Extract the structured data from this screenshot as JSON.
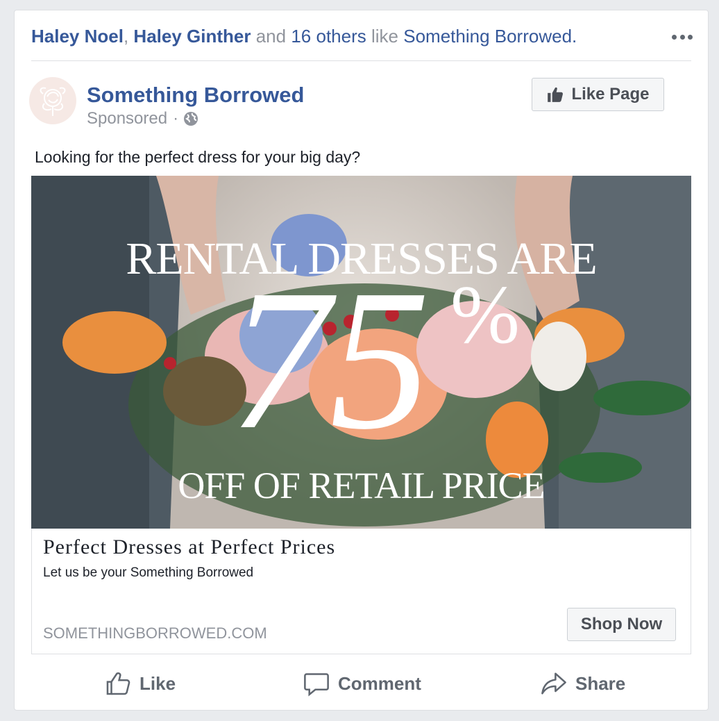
{
  "social_context": {
    "friend1": "Haley Noel",
    "separator": ",",
    "friend2": "Haley Ginther",
    "and": "and",
    "others": "16 others",
    "like": "like",
    "page": "Something Borrowed."
  },
  "post": {
    "page_name": "Something Borrowed",
    "sponsored": "Sponsored",
    "dot": "·",
    "like_page_label": "Like Page",
    "text": "Looking for the perfect dress for your big day?"
  },
  "image_text": {
    "line1": "RENTAL DRESSES ARE",
    "big_number": "75",
    "percent": "%",
    "line3": "OFF OF RETAIL PRICE"
  },
  "link_preview": {
    "headline": "Perfect Dresses at Perfect Prices",
    "description": "Let us be your Something Borrowed",
    "domain": "SOMETHINGBORROWED.COM",
    "cta": "Shop Now"
  },
  "actions": {
    "like": "Like",
    "comment": "Comment",
    "share": "Share"
  },
  "icons": {
    "more": "more-dots-icon",
    "globe": "globe-icon",
    "thumbs_up": "thumbs-up-icon",
    "comment": "comment-bubble-icon",
    "share": "share-arrow-icon",
    "avatar": "rose-logo-icon"
  },
  "colors": {
    "link_blue": "#365899",
    "muted": "#90949c",
    "button_text": "#4b4f56",
    "action_text": "#606770"
  }
}
